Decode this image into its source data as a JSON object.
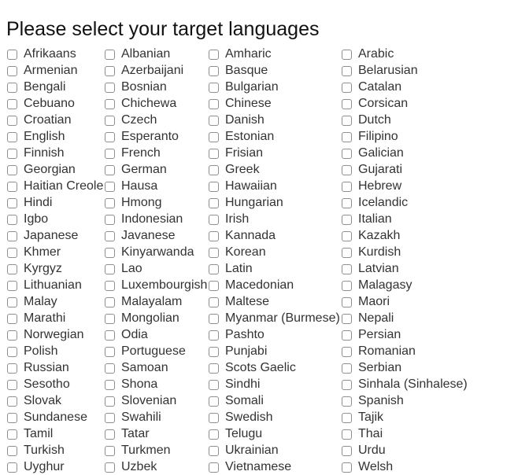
{
  "page": {
    "title": "Please select your target languages"
  },
  "columns": 4,
  "languages": [
    "Afrikaans",
    "Albanian",
    "Amharic",
    "Arabic",
    "Armenian",
    "Azerbaijani",
    "Basque",
    "Belarusian",
    "Bengali",
    "Bosnian",
    "Bulgarian",
    "Catalan",
    "Cebuano",
    "Chichewa",
    "Chinese",
    "Corsican",
    "Croatian",
    "Czech",
    "Danish",
    "Dutch",
    "English",
    "Esperanto",
    "Estonian",
    "Filipino",
    "Finnish",
    "French",
    "Frisian",
    "Galician",
    "Georgian",
    "German",
    "Greek",
    "Gujarati",
    "Haitian Creole",
    "Hausa",
    "Hawaiian",
    "Hebrew",
    "Hindi",
    "Hmong",
    "Hungarian",
    "Icelandic",
    "Igbo",
    "Indonesian",
    "Irish",
    "Italian",
    "Japanese",
    "Javanese",
    "Kannada",
    "Kazakh",
    "Khmer",
    "Kinyarwanda",
    "Korean",
    "Kurdish",
    "Kyrgyz",
    "Lao",
    "Latin",
    "Latvian",
    "Lithuanian",
    "Luxembourgish",
    "Macedonian",
    "Malagasy",
    "Malay",
    "Malayalam",
    "Maltese",
    "Maori",
    "Marathi",
    "Mongolian",
    "Myanmar (Burmese)",
    "Nepali",
    "Norwegian",
    "Odia",
    "Pashto",
    "Persian",
    "Polish",
    "Portuguese",
    "Punjabi",
    "Romanian",
    "Russian",
    "Samoan",
    "Scots Gaelic",
    "Serbian",
    "Sesotho",
    "Shona",
    "Sindhi",
    "Sinhala (Sinhalese)",
    "Slovak",
    "Slovenian",
    "Somali",
    "Spanish",
    "Sundanese",
    "Swahili",
    "Swedish",
    "Tajik",
    "Tamil",
    "Tatar",
    "Telugu",
    "Thai",
    "Turkish",
    "Turkmen",
    "Ukrainian",
    "Urdu",
    "Uyghur",
    "Uzbek",
    "Vietnamese",
    "Welsh"
  ],
  "selected": []
}
